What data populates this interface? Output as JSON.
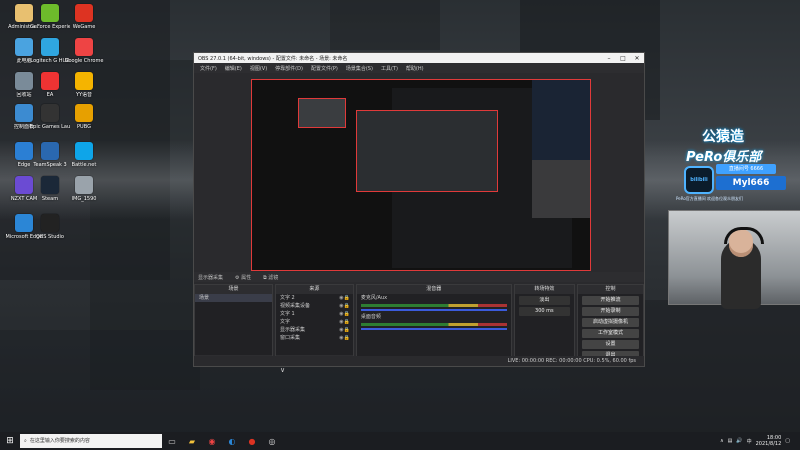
{
  "desktop": {
    "icons": [
      {
        "label": "Administra...",
        "color": "#e8c070"
      },
      {
        "label": "此电脑",
        "color": "#4aa3e0"
      },
      {
        "label": "回收站",
        "color": "#7a8b99"
      },
      {
        "label": "控制面板",
        "color": "#3c8bd1"
      },
      {
        "label": "Edge",
        "color": "#2b7fd4"
      },
      {
        "label": "NZXT CAM",
        "color": "#6b4bd3"
      },
      {
        "label": "Microsoft Edge",
        "color": "#2b86d6"
      },
      {
        "label": "GeForce Experience",
        "color": "#6dbb2b"
      },
      {
        "label": "Logitech G HUB",
        "color": "#2fa6e0"
      },
      {
        "label": "EA",
        "color": "#e33"
      },
      {
        "label": "Epic Games Launcher",
        "color": "#333"
      },
      {
        "label": "TeamSpeak 3",
        "color": "#2a68b0"
      },
      {
        "label": "Steam",
        "color": "#1b2838"
      },
      {
        "label": "OBS Studio",
        "color": "#222"
      },
      {
        "label": "WeGame",
        "color": "#d32"
      },
      {
        "label": "Google Chrome",
        "color": "#e44"
      },
      {
        "label": "YY语音",
        "color": "#f5b400"
      },
      {
        "label": "PUBG",
        "color": "#e7a000"
      },
      {
        "label": "Battle.net",
        "color": "#0ea5e9"
      },
      {
        "label": "IMG_1590",
        "color": "#9aa3ab"
      }
    ]
  },
  "obs": {
    "title": "OBS 27.0.1 (64-bit, windows) - 配置文件: 未命名 - 场景: 未命名",
    "menu": [
      "文件(F)",
      "编辑(E)",
      "视图(V)",
      "停靠部件(D)",
      "配置文件(P)",
      "场景集合(S)",
      "工具(T)",
      "帮助(H)"
    ],
    "scene_bar": [
      "显示器采集",
      "⚙ 属性",
      "⧉ 滤镜"
    ],
    "docks": {
      "scenes": {
        "title": "场景",
        "items": [
          "场景"
        ]
      },
      "sources": {
        "title": "来源",
        "items": [
          "文字 2",
          "视频采集设备",
          "文字 1",
          "文字",
          "显示器采集",
          "窗口采集"
        ]
      },
      "mixer": {
        "title": "混音器",
        "items": [
          "麦克风/Aux",
          "桌面音频"
        ]
      },
      "transitions": {
        "title": "转场特效",
        "mode": "淡出",
        "duration": "300 ms"
      },
      "controls": {
        "title": "控制",
        "buttons": [
          "开始推流",
          "开始录制",
          "启动虚拟摄像机",
          "工作室模式",
          "设置",
          "退出"
        ]
      }
    },
    "status": "LIVE: 00:00:00   REC: 00:00:00   CPU: 0.5%, 60.00 fps"
  },
  "overlay": {
    "title_cn": "公猿造",
    "title_en": "PeRo俱乐部",
    "platform": "bilibili",
    "room": "直播间号 6666",
    "uid": "Myl666",
    "footer": "PeRo官方直播间  欢迎各位观众朋友们"
  },
  "taskbar": {
    "search_placeholder": "在这里输入你要搜索的内容",
    "time": "18:00",
    "date": "2021/8/12",
    "lang": "中"
  }
}
